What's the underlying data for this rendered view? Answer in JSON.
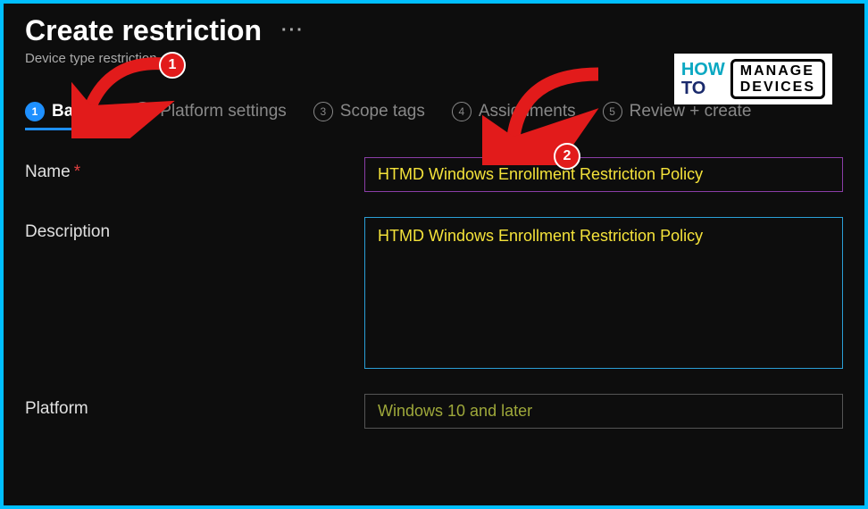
{
  "header": {
    "title": "Create restriction",
    "subtitle": "Device type restriction"
  },
  "tabs": [
    {
      "num": "1",
      "label": "Basics",
      "active": true
    },
    {
      "num": "2",
      "label": "Platform settings",
      "active": false
    },
    {
      "num": "3",
      "label": "Scope tags",
      "active": false
    },
    {
      "num": "4",
      "label": "Assignments",
      "active": false
    },
    {
      "num": "5",
      "label": "Review + create",
      "active": false
    }
  ],
  "form": {
    "name_label": "Name",
    "name_value": "HTMD Windows Enrollment Restriction Policy",
    "description_label": "Description",
    "description_value": "HTMD Windows Enrollment Restriction Policy",
    "platform_label": "Platform",
    "platform_value": "Windows 10 and later"
  },
  "annotations": {
    "badge1": "1",
    "badge2": "2"
  },
  "logo": {
    "how": "HOW",
    "to": "TO",
    "line1": "MANAGE",
    "line2": "DEVICES"
  }
}
